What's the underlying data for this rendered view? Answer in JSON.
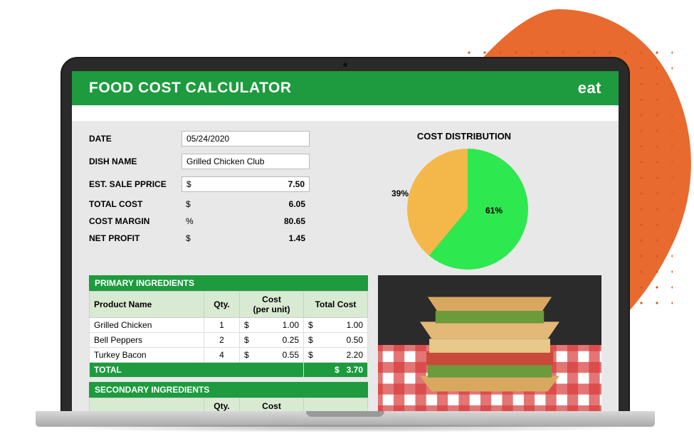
{
  "header": {
    "title": "FOOD COST CALCULATOR",
    "brand": "eat"
  },
  "form": {
    "date_label": "DATE",
    "dish_label": "DISH NAME",
    "price_label": "EST. SALE PPRICE",
    "total_cost_label": "TOTAL COST",
    "margin_label": "COST MARGIN",
    "profit_label": "NET PROFIT",
    "date_value": "05/24/2020",
    "dish_value": "Grilled Chicken Club",
    "price_currency": "$",
    "price_value": "7.50",
    "total_cost_currency": "$",
    "total_cost_value": "6.05",
    "margin_unit": "%",
    "margin_value": "80.65",
    "profit_currency": "$",
    "profit_value": "1.45"
  },
  "chart_title": "COST DISTRIBUTION",
  "chart_data": {
    "type": "pie",
    "title": "COST DISTRIBUTION",
    "categories": [
      "Primary Ingredients",
      "Secondary Ingredients"
    ],
    "values": [
      61,
      39
    ],
    "labels": [
      "61%",
      "39%"
    ],
    "colors": [
      "#2ee84f",
      "#f4b84a"
    ]
  },
  "primary": {
    "section_title": "PRIMARY INGREDIENTS",
    "headers": {
      "name": "Product Name",
      "qty": "Qty.",
      "cost": "Cost\n(per unit)",
      "total": "Total Cost"
    },
    "rows": [
      {
        "name": "Grilled Chicken",
        "qty": "1",
        "cost_sym": "$",
        "cost_val": "1.00",
        "total_sym": "$",
        "total_val": "1.00"
      },
      {
        "name": "Bell Peppers",
        "qty": "2",
        "cost_sym": "$",
        "cost_val": "0.25",
        "total_sym": "$",
        "total_val": "0.50"
      },
      {
        "name": "Turkey Bacon",
        "qty": "4",
        "cost_sym": "$",
        "cost_val": "0.55",
        "total_sym": "$",
        "total_val": "2.20"
      }
    ],
    "total_label": "TOTAL",
    "total_sym": "$",
    "total_val": "3.70"
  },
  "secondary": {
    "section_title": "SECONDARY INGREDIENTS",
    "headers": {
      "qty": "Qty.",
      "cost": "Cost"
    }
  }
}
